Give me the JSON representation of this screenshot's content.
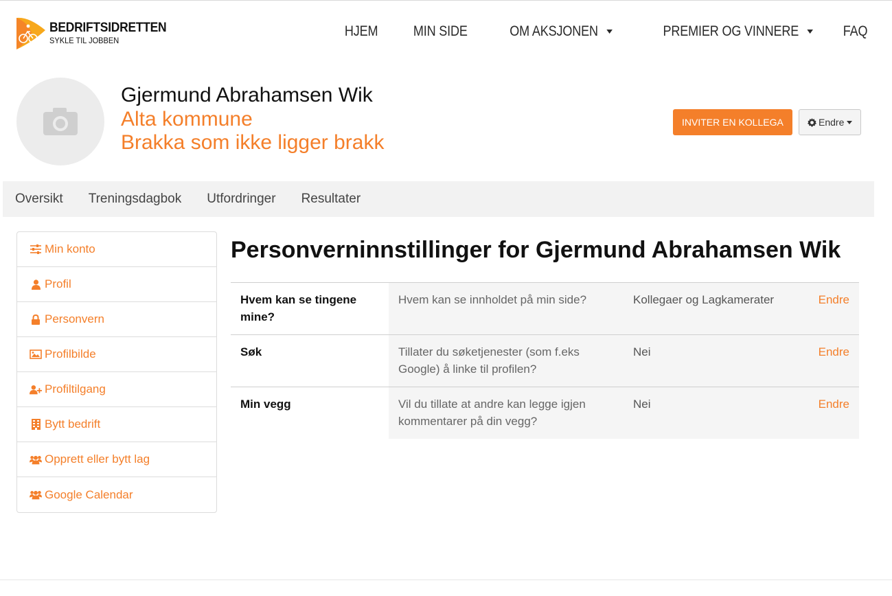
{
  "brand": {
    "name": "BEDRIFTSIDRETTEN",
    "tagline": "SYKLE TIL JOBBEN",
    "accent": "#f47f2a"
  },
  "nav": [
    {
      "label": "HJEM",
      "dropdown": false
    },
    {
      "label": "MIN SIDE",
      "dropdown": false
    },
    {
      "label": "OM AKSJONEN",
      "dropdown": true
    },
    {
      "label": "PREMIER OG VINNERE",
      "dropdown": true
    },
    {
      "label": "FAQ",
      "dropdown": false
    }
  ],
  "profile": {
    "name": "Gjermund Abrahamsen Wik",
    "organization": "Alta kommune",
    "team": "Brakka som ikke ligger brakk",
    "invite_label": "INVITER EN KOLLEGA",
    "edit_label": "Endre"
  },
  "tabs": [
    "Oversikt",
    "Treningsdagbok",
    "Utfordringer",
    "Resultater"
  ],
  "sidebar": [
    {
      "label": "Min konto",
      "icon": "sliders-icon"
    },
    {
      "label": "Profil",
      "icon": "user-icon"
    },
    {
      "label": "Personvern",
      "icon": "lock-icon"
    },
    {
      "label": "Profilbilde",
      "icon": "image-icon"
    },
    {
      "label": "Profiltilgang",
      "icon": "user-plus-icon"
    },
    {
      "label": "Bytt bedrift",
      "icon": "building-icon"
    },
    {
      "label": "Opprett eller bytt lag",
      "icon": "users-icon"
    },
    {
      "label": "Google Calendar",
      "icon": "users-icon"
    }
  ],
  "main": {
    "title": "Personverninnstillinger for Gjermund Abrahamsen Wik",
    "rows": [
      {
        "label": "Hvem kan se tingene mine?",
        "question": "Hvem kan se innholdet på min side?",
        "value": "Kollegaer og Lagkamerater",
        "action": "Endre"
      },
      {
        "label": "Søk",
        "question": "Tillater du søketjenester (som f.eks Google) å linke til profilen?",
        "value": "Nei",
        "action": "Endre"
      },
      {
        "label": "Min vegg",
        "question": "Vil du tillate at andre kan legge igjen kommentarer på din vegg?",
        "value": "Nei",
        "action": "Endre"
      }
    ]
  }
}
